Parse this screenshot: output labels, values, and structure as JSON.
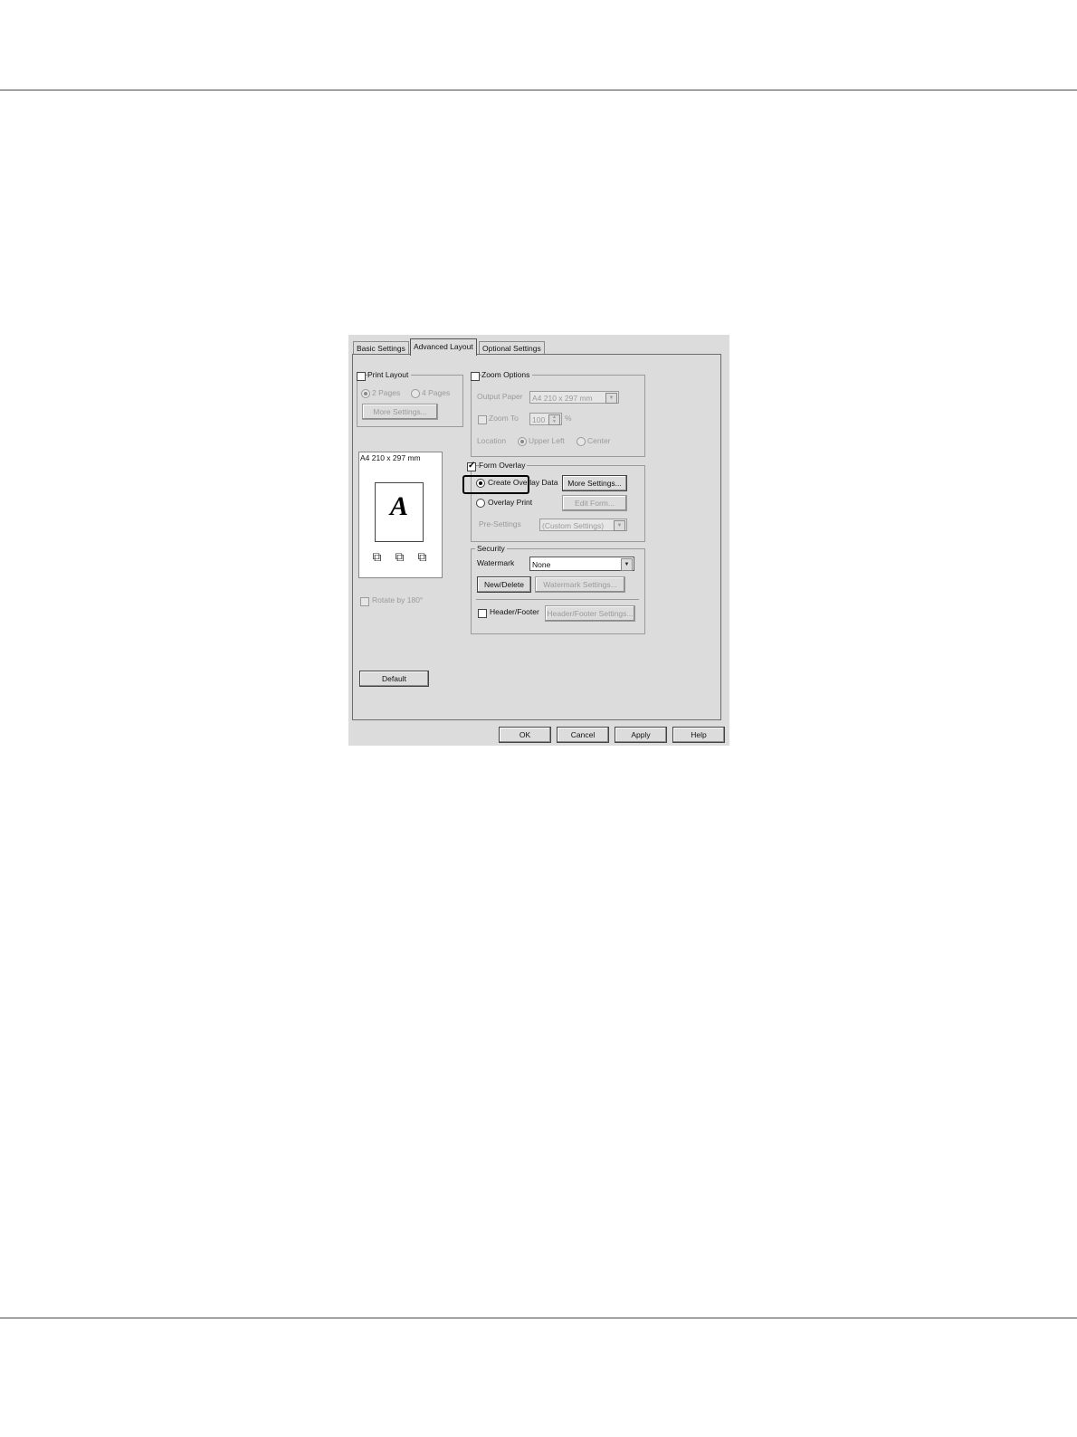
{
  "dialog": {
    "tabs": [
      "Basic Settings",
      "Advanced Layout",
      "Optional Settings"
    ],
    "active_tab": "Advanced Layout",
    "print_layout": {
      "label": "Print Layout",
      "checked": false,
      "option_2_pages": "2 Pages",
      "option_4_pages": "4 Pages",
      "more_settings": "More Settings..."
    },
    "preview": {
      "paper_label": "A4 210 x 297 mm",
      "letter": "A"
    },
    "rotate_label": "Rotate by 180°",
    "default_button": "Default",
    "zoom_options": {
      "label": "Zoom Options",
      "output_paper_label": "Output Paper",
      "output_paper_value": "A4 210 x 297 mm",
      "zoom_to_label": "Zoom To",
      "zoom_value": "100",
      "zoom_unit": "%",
      "location_label": "Location",
      "upper_left": "Upper Left",
      "center": "Center"
    },
    "form_overlay": {
      "label": "Form Overlay",
      "checked": true,
      "create_overlay_data": "Create Overlay Data",
      "more_settings": "More Settings...",
      "overlay_print": "Overlay Print",
      "edit_form": "Edit Form...",
      "pre_settings_label": "Pre-Settings",
      "pre_settings_value": "(Custom Settings)"
    },
    "security": {
      "label": "Security",
      "watermark_label": "Watermark",
      "watermark_value": "None",
      "new_delete": "New/Delete",
      "watermark_settings": "Watermark Settings...",
      "header_footer_label": "Header/Footer",
      "header_footer_settings": "Header/Footer Settings..."
    },
    "buttons": {
      "ok": "OK",
      "cancel": "Cancel",
      "apply": "Apply",
      "help": "Help"
    }
  }
}
